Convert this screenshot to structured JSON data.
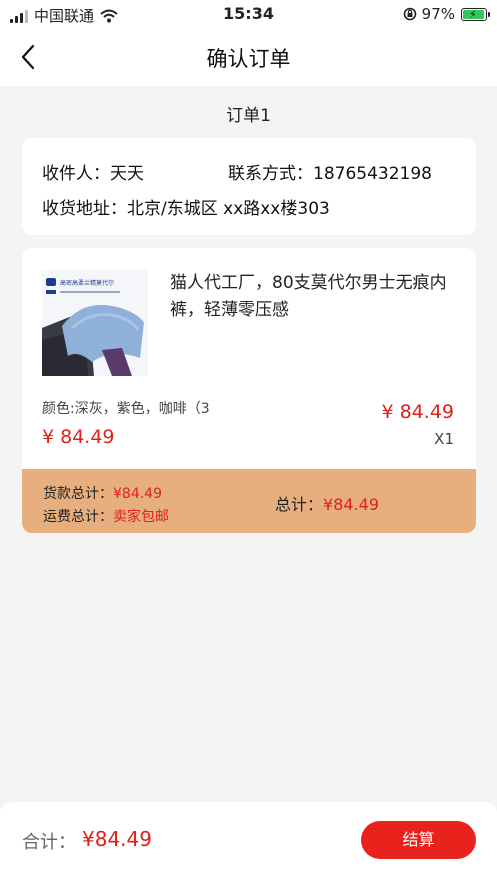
{
  "status_bar": {
    "carrier": "中国联通",
    "time": "15:34",
    "battery": "97%",
    "icons": [
      "signal-icon",
      "wifi-icon",
      "orientation-lock-icon",
      "battery-charging-icon"
    ]
  },
  "nav": {
    "title": "确认订单",
    "back_icon": "back-chevron-icon"
  },
  "order": {
    "label": "订单1",
    "address": {
      "recipient": "收件人：天天",
      "contact": "联系方式：18765432198",
      "address": "收货地址：北京/东城区 xx路xx楼303"
    },
    "product": {
      "title": "猫人代工厂，80支莫代尔男士无痕内裤，轻薄零压感",
      "image_label": "高密高柔兰精莫代尔",
      "spec": "颜色:深灰，紫色，咖啡（3",
      "price": "¥ 84.49",
      "unit_price": "¥ 84.49",
      "quantity": "X1"
    },
    "summary": {
      "goods_label": "货款总计：",
      "goods_value": "¥84.49",
      "shipping_label": "运费总计：",
      "shipping_value": "卖家包邮",
      "total_label": "总计：",
      "total_value": "¥84.49"
    }
  },
  "footer": {
    "total_label": "合计：",
    "total_value": "¥84.49",
    "checkout_label": "结算"
  },
  "colors": {
    "accent_red": "#e8231d",
    "price_red": "#e0201a",
    "summary_bg": "#e7af7d",
    "page_bg": "#f4f4f4"
  }
}
